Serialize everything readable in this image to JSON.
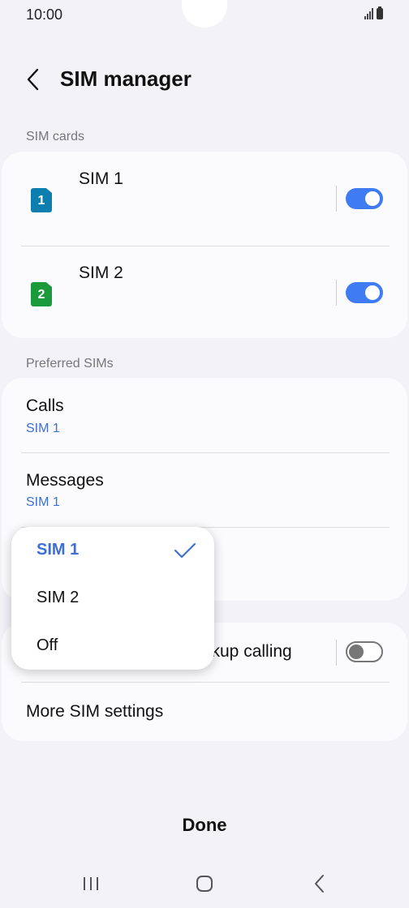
{
  "status_bar": {
    "time": "10:00"
  },
  "header": {
    "title": "SIM manager"
  },
  "sections": {
    "sim_cards": "SIM cards",
    "preferred_sims": "Preferred SIMs"
  },
  "sim_cards": [
    {
      "badge": "1",
      "name": "SIM 1",
      "color": "#0c7fb0",
      "enabled": true
    },
    {
      "badge": "2",
      "name": "SIM 2",
      "color": "#1b9a3c",
      "enabled": true
    }
  ],
  "preferred": {
    "calls": {
      "title": "Calls",
      "value": "SIM 1"
    },
    "messages": {
      "title": "Messages",
      "value": "SIM 1"
    }
  },
  "backup_calling": {
    "label_visible": "ckup calling",
    "enabled": false
  },
  "more_settings": "More SIM settings",
  "popup": {
    "options": [
      "SIM 1",
      "SIM 2",
      "Off"
    ],
    "selected": "SIM 1"
  },
  "done_label": "Done",
  "colors": {
    "accent": "#3f7cf4",
    "link": "#3d6fd6",
    "background": "#f2f2f7",
    "card": "#fbfbfd"
  }
}
